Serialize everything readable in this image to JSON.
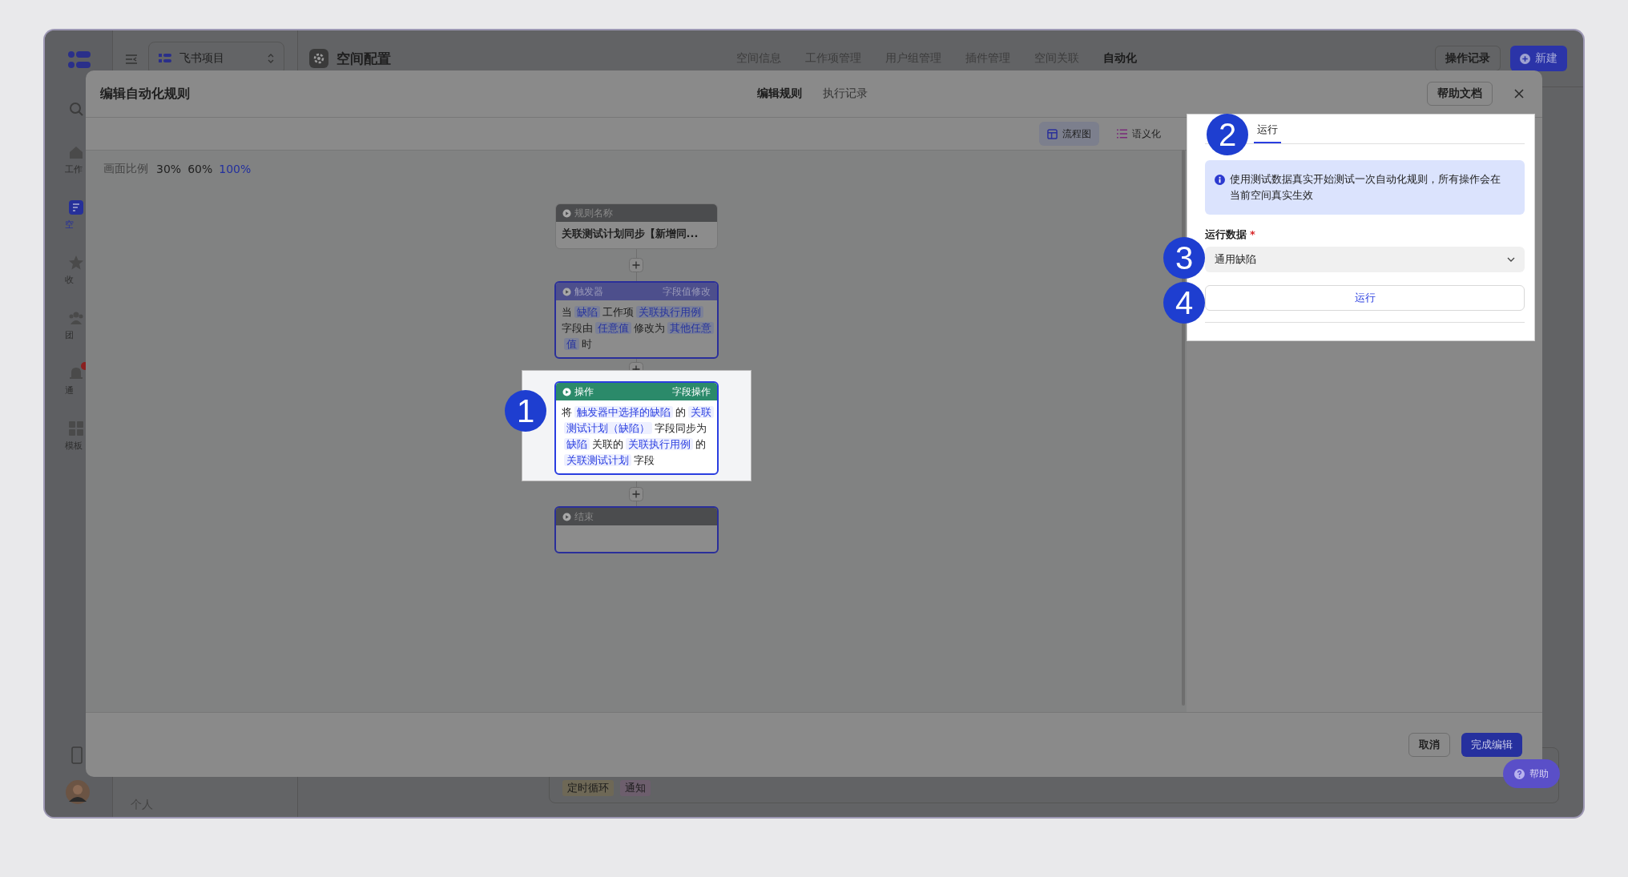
{
  "app": {
    "project": "飞书项目",
    "space_title": "空间配置",
    "nav": [
      {
        "label": "空间信息",
        "selected": false
      },
      {
        "label": "工作项管理",
        "selected": false
      },
      {
        "label": "用户组管理",
        "selected": false
      },
      {
        "label": "插件管理",
        "selected": false
      },
      {
        "label": "空间关联",
        "selected": false
      },
      {
        "label": "自动化",
        "selected": true
      }
    ],
    "history_button": "操作记录",
    "new_button": "新建",
    "rail": [
      {
        "kind": "home",
        "label": "工作",
        "selected": false,
        "badge": false
      },
      {
        "kind": "space",
        "label": "空",
        "selected": true,
        "badge": false
      },
      {
        "kind": "star",
        "label": "收",
        "selected": false,
        "badge": false
      },
      {
        "kind": "team",
        "label": "团",
        "selected": false,
        "badge": false
      },
      {
        "kind": "bell",
        "label": "通",
        "selected": false,
        "badge": true
      },
      {
        "kind": "grid",
        "label": "模板",
        "selected": false,
        "badge": false
      }
    ],
    "personal_label": "个人",
    "tags": [
      {
        "label": "定时循环",
        "color": "#6e6856"
      },
      {
        "label": "通知",
        "color": "#6d5e6d"
      }
    ]
  },
  "modal": {
    "title": "编辑自动化规则",
    "tabs": [
      {
        "label": "编辑规则",
        "selected": true
      },
      {
        "label": "执行记录",
        "selected": false
      }
    ],
    "help_button": "帮助文档",
    "view_modes": [
      {
        "kind": "flow",
        "label": "流程图",
        "selected": true
      },
      {
        "kind": "list",
        "label": "语义化",
        "selected": false
      }
    ],
    "zoom": {
      "label": "画面比例",
      "options": [
        {
          "label": "30%",
          "selected": false
        },
        {
          "label": "60%",
          "selected": false
        },
        {
          "label": "100%",
          "selected": true
        }
      ]
    },
    "flow": [
      {
        "kind": "name",
        "title": "规则名称",
        "highlighted": false,
        "body": [
          {
            "text": "关联测试计划同步【新增同...",
            "chip": false
          }
        ]
      },
      {
        "kind": "trigger",
        "title": "触发器",
        "subtitle": "字段值修改",
        "highlighted": false,
        "body": [
          {
            "text": "当",
            "chip": false
          },
          {
            "text": "缺陷",
            "chip": true
          },
          {
            "text": "工作项",
            "chip": false
          },
          {
            "text": "关联执行用例",
            "chip": true
          },
          {
            "text": "字段由",
            "chip": false
          },
          {
            "text": "任意值",
            "chip": true
          },
          {
            "text": "修改为",
            "chip": false
          },
          {
            "text": "其他任意值",
            "chip": true
          },
          {
            "text": "时",
            "chip": false
          }
        ]
      },
      {
        "kind": "action",
        "title": "操作",
        "subtitle": "字段操作",
        "highlighted": true,
        "body": [
          {
            "text": "将",
            "chip": false
          },
          {
            "text": "触发器中选择的缺陷",
            "chip": true
          },
          {
            "text": "的",
            "chip": false
          },
          {
            "text": "关联测试计划（缺陷）",
            "chip": true
          },
          {
            "text": "字段同步为",
            "chip": false
          },
          {
            "text": "缺陷",
            "chip": true
          },
          {
            "text": "关联的",
            "chip": false
          },
          {
            "text": "关联执行用例",
            "chip": true
          },
          {
            "text": "的",
            "chip": false
          },
          {
            "text": "关联测试计划",
            "chip": true
          },
          {
            "text": "字段",
            "chip": false
          }
        ]
      },
      {
        "kind": "end",
        "title": "结束",
        "highlighted": false
      }
    ],
    "panel": {
      "tabs": [
        {
          "label": "运行",
          "selected": true
        }
      ],
      "notice": "使用测试数据真实开始测试一次自动化规则，所有操作会在当前空间真实生效",
      "field_label": "运行数据",
      "required_mark": "*",
      "select_value": "通用缺陷",
      "run_button": "运行"
    },
    "footer": {
      "cancel": "取消",
      "done": "完成编辑"
    }
  },
  "help_fab": "帮助",
  "markers": [
    "1",
    "2",
    "3",
    "4"
  ]
}
